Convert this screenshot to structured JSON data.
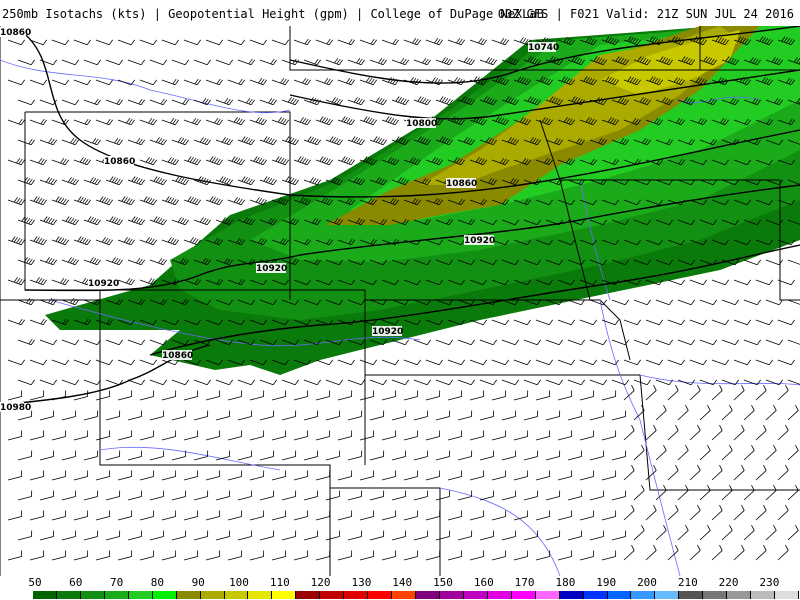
{
  "header": {
    "title_left": "250mb Isotachs (kts) | Geopotential Height (gpm) | College of DuPage NeXLaB",
    "title_right": "00Z GFS | F021 Valid: 21Z SUN JUL 24 2016"
  },
  "map": {
    "height_contour_labels": [
      "10860",
      "10740",
      "10800",
      "10860",
      "10860",
      "10920",
      "10920",
      "10920",
      "10920",
      "10860",
      "10980"
    ],
    "colors": {
      "background": "#ffffff",
      "state_borders": "#000000",
      "rivers": "#6a6aff",
      "height_contours": "#000000",
      "wind_barbs": "#000000"
    }
  },
  "legend": {
    "labels": [
      "50",
      "60",
      "70",
      "80",
      "90",
      "100",
      "110",
      "120",
      "130",
      "140",
      "150",
      "160",
      "170",
      "180",
      "190",
      "200",
      "210",
      "220",
      "230"
    ],
    "colors": [
      "#006400",
      "#0a7a0a",
      "#129012",
      "#1aaa1a",
      "#22cc22",
      "#00ee00",
      "#8a8a00",
      "#aaaa00",
      "#c8c800",
      "#e6e600",
      "#ffff00",
      "#9a0000",
      "#c00000",
      "#e00000",
      "#ff0000",
      "#ff4000",
      "#800080",
      "#a000a0",
      "#c000c0",
      "#e000e0",
      "#ff00ff",
      "#ff66ff",
      "#0000c0",
      "#0033ff",
      "#0066ff",
      "#3399ff",
      "#66bbff",
      "#555555",
      "#777777",
      "#999999",
      "#bbbbbb",
      "#dddddd"
    ]
  }
}
